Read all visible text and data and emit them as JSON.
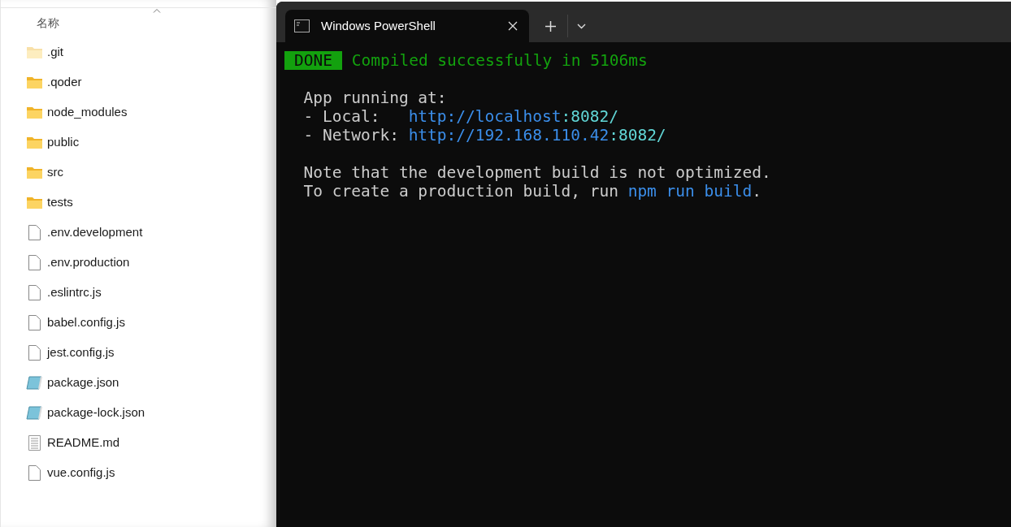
{
  "explorer": {
    "column_header": "名称",
    "items": [
      {
        "name": ".git",
        "kind": "folder",
        "hidden": true
      },
      {
        "name": ".qoder",
        "kind": "folder",
        "hidden": false
      },
      {
        "name": "node_modules",
        "kind": "folder",
        "hidden": false
      },
      {
        "name": "public",
        "kind": "folder",
        "hidden": false
      },
      {
        "name": "src",
        "kind": "folder",
        "hidden": false
      },
      {
        "name": "tests",
        "kind": "folder",
        "hidden": false
      },
      {
        "name": ".env.development",
        "kind": "file",
        "hidden": false
      },
      {
        "name": ".env.production",
        "kind": "file",
        "hidden": false
      },
      {
        "name": ".eslintrc.js",
        "kind": "file",
        "hidden": false
      },
      {
        "name": "babel.config.js",
        "kind": "file",
        "hidden": false
      },
      {
        "name": "jest.config.js",
        "kind": "file",
        "hidden": false
      },
      {
        "name": "package.json",
        "kind": "json",
        "hidden": false
      },
      {
        "name": "package-lock.json",
        "kind": "json",
        "hidden": false
      },
      {
        "name": "README.md",
        "kind": "text",
        "hidden": false
      },
      {
        "name": "vue.config.js",
        "kind": "file",
        "hidden": false
      }
    ]
  },
  "terminal": {
    "tab": {
      "title": "Windows PowerShell",
      "selected": true
    },
    "blocks": [
      [
        [
          {
            "text": "DONE",
            "kind": "badge"
          },
          {
            "text": " Compiled successfully in 5106ms",
            "kind": "success"
          }
        ]
      ],
      [
        [
          {
            "text": "  App running at:",
            "kind": "plain"
          }
        ],
        [
          {
            "text": "  - Local:   ",
            "kind": "plain"
          },
          {
            "text": "http://localhost",
            "kind": "link"
          },
          {
            "text": ":8082/",
            "kind": "port"
          }
        ],
        [
          {
            "text": "  - Network: ",
            "kind": "plain"
          },
          {
            "text": "http://192.168.110.42",
            "kind": "link"
          },
          {
            "text": ":8082/",
            "kind": "port"
          }
        ]
      ],
      [
        [
          {
            "text": "  Note that the development build is not optimized.",
            "kind": "plain"
          }
        ],
        [
          {
            "text": "  To create a production build, run ",
            "kind": "plain"
          },
          {
            "text": "npm run build",
            "kind": "link"
          },
          {
            "text": ".",
            "kind": "plain"
          }
        ]
      ]
    ]
  }
}
